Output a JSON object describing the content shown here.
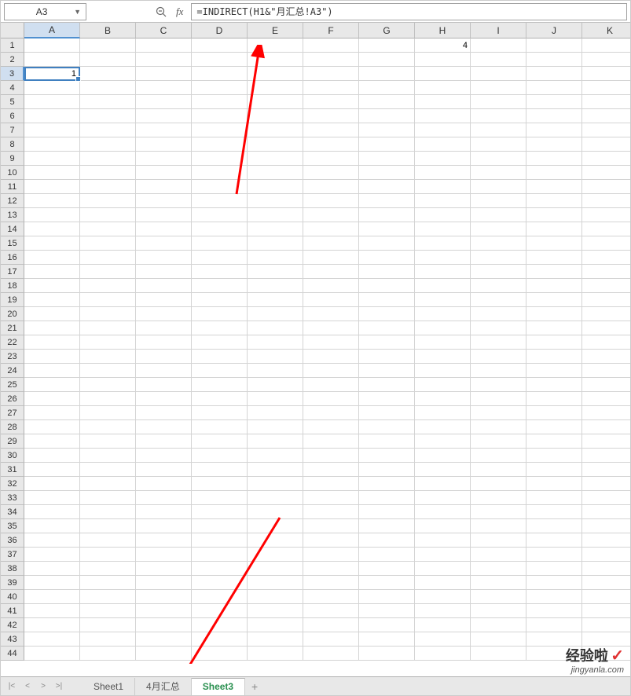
{
  "formula_bar": {
    "cell_ref": "A3",
    "fx_label": "fx",
    "formula": "=INDIRECT(H1&\"月汇总!A3\")"
  },
  "columns": [
    "A",
    "B",
    "C",
    "D",
    "E",
    "F",
    "G",
    "H",
    "I",
    "J",
    "K"
  ],
  "selected_col_index": 0,
  "row_count": 44,
  "selected_row": 3,
  "cells": {
    "H1": "4",
    "A3": "1"
  },
  "sheet_tabs": {
    "nav": {
      "first": "|<",
      "prev": "<",
      "next": ">",
      "last": ">|"
    },
    "tabs": [
      {
        "name": "Sheet1",
        "active": false
      },
      {
        "name": "4月汇总",
        "active": false
      },
      {
        "name": "Sheet3",
        "active": true
      }
    ],
    "add": "+"
  },
  "watermark": {
    "main": "经验啦",
    "check": "✓",
    "sub": "jingyanla.com"
  }
}
